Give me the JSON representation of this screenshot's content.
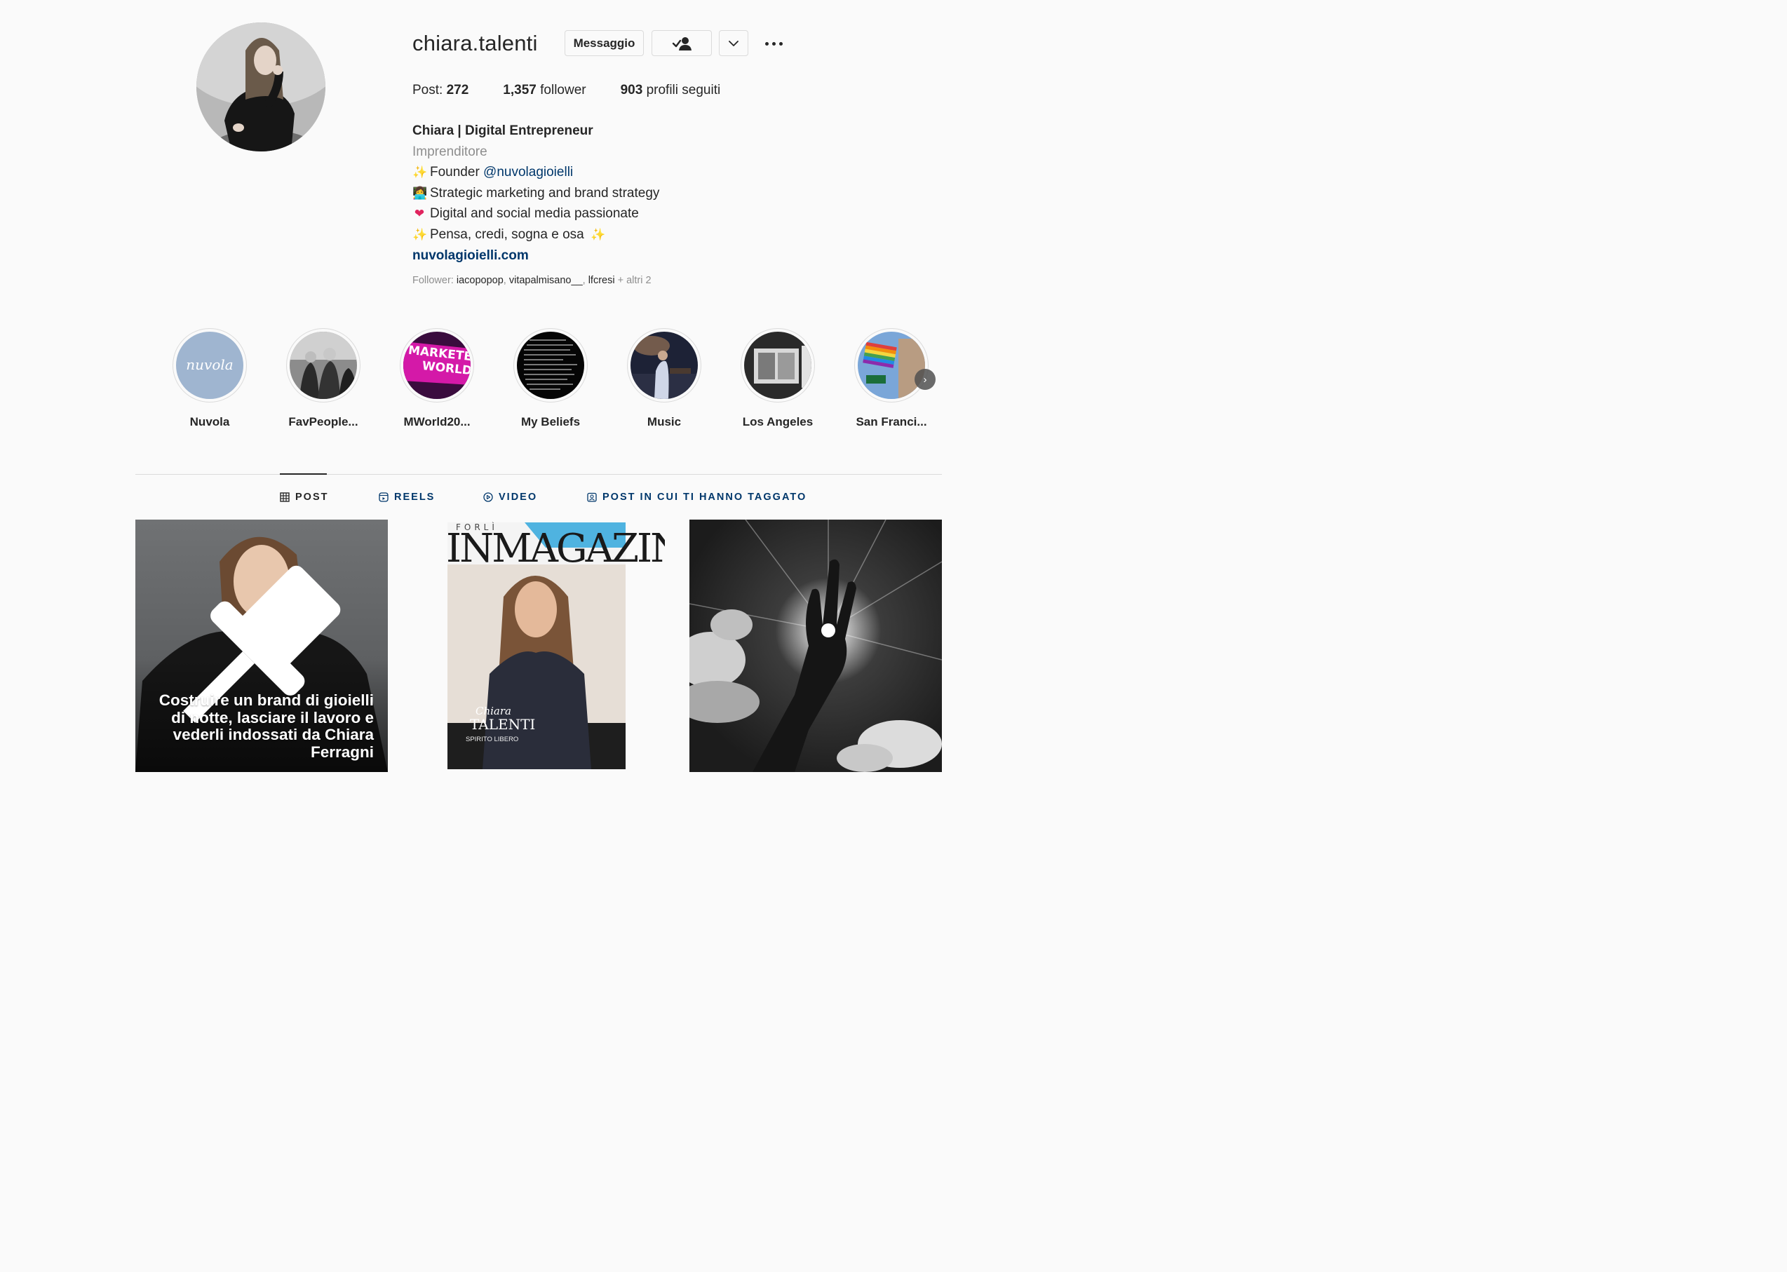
{
  "profile": {
    "username": "chiara.talenti",
    "buttons": {
      "message": "Messaggio"
    },
    "stats": {
      "posts_label": "Post:",
      "posts_value": "272",
      "followers_value": "1,357",
      "followers_label": "follower",
      "following_value": "903",
      "following_label": "profili seguiti"
    },
    "bio": {
      "full_name": "Chiara | Digital Entrepreneur",
      "category": "Imprenditore",
      "line1_prefix": "Founder ",
      "line1_mention": "@nuvolagioielli",
      "line2": "Strategic marketing and brand strategy",
      "line3": "Digital and social media passionate",
      "line4": "Pensa, credi, sogna e osa",
      "website": "nuvolagioielli.com"
    },
    "followed_by": {
      "label": "Follower:",
      "users": [
        "iacopopop",
        "vitapalmisano__",
        "lfcresi"
      ],
      "more": "+ altri 2"
    }
  },
  "highlights": [
    {
      "label": "Nuvola"
    },
    {
      "label": "FavPeople..."
    },
    {
      "label": "MWorld20..."
    },
    {
      "label": "My Beliefs"
    },
    {
      "label": "Music"
    },
    {
      "label": "Los Angeles"
    },
    {
      "label": "San Franci..."
    }
  ],
  "highlight_texts": {
    "nuvola_logo": "nuvola",
    "marketing": "MARKETE",
    "world": "WORLD"
  },
  "tabs": {
    "posts": "POST",
    "reels": "REELS",
    "video": "VIDEO",
    "tagged": "POST IN CUI TI HANNO TAGGATO"
  },
  "posts": {
    "post1_caption": "Costruire un brand di gioielli di notte, lasciare il lavoro e vederli indossati da Chiara Ferragni",
    "post2_magazine": {
      "masthead_top": "FORLÌ",
      "masthead": "INMAGAZINE",
      "name_script": "Chiara",
      "name": "TALENTI",
      "subtitle": "SPIRITO LIBERO"
    }
  },
  "colors": {
    "link": "#00376b",
    "text": "#262626",
    "muted": "#8e8e8e",
    "border": "#dbdbdb",
    "background": "#fafafa"
  },
  "icons": {
    "follow": "person-check-icon",
    "dropdown": "chevron-down-icon",
    "more": "more-horizontal-icon",
    "posts_tab": "grid-icon",
    "reels_tab": "reels-icon",
    "video_tab": "play-circle-icon",
    "tagged_tab": "tag-portrait-icon",
    "pinned": "pin-icon"
  }
}
